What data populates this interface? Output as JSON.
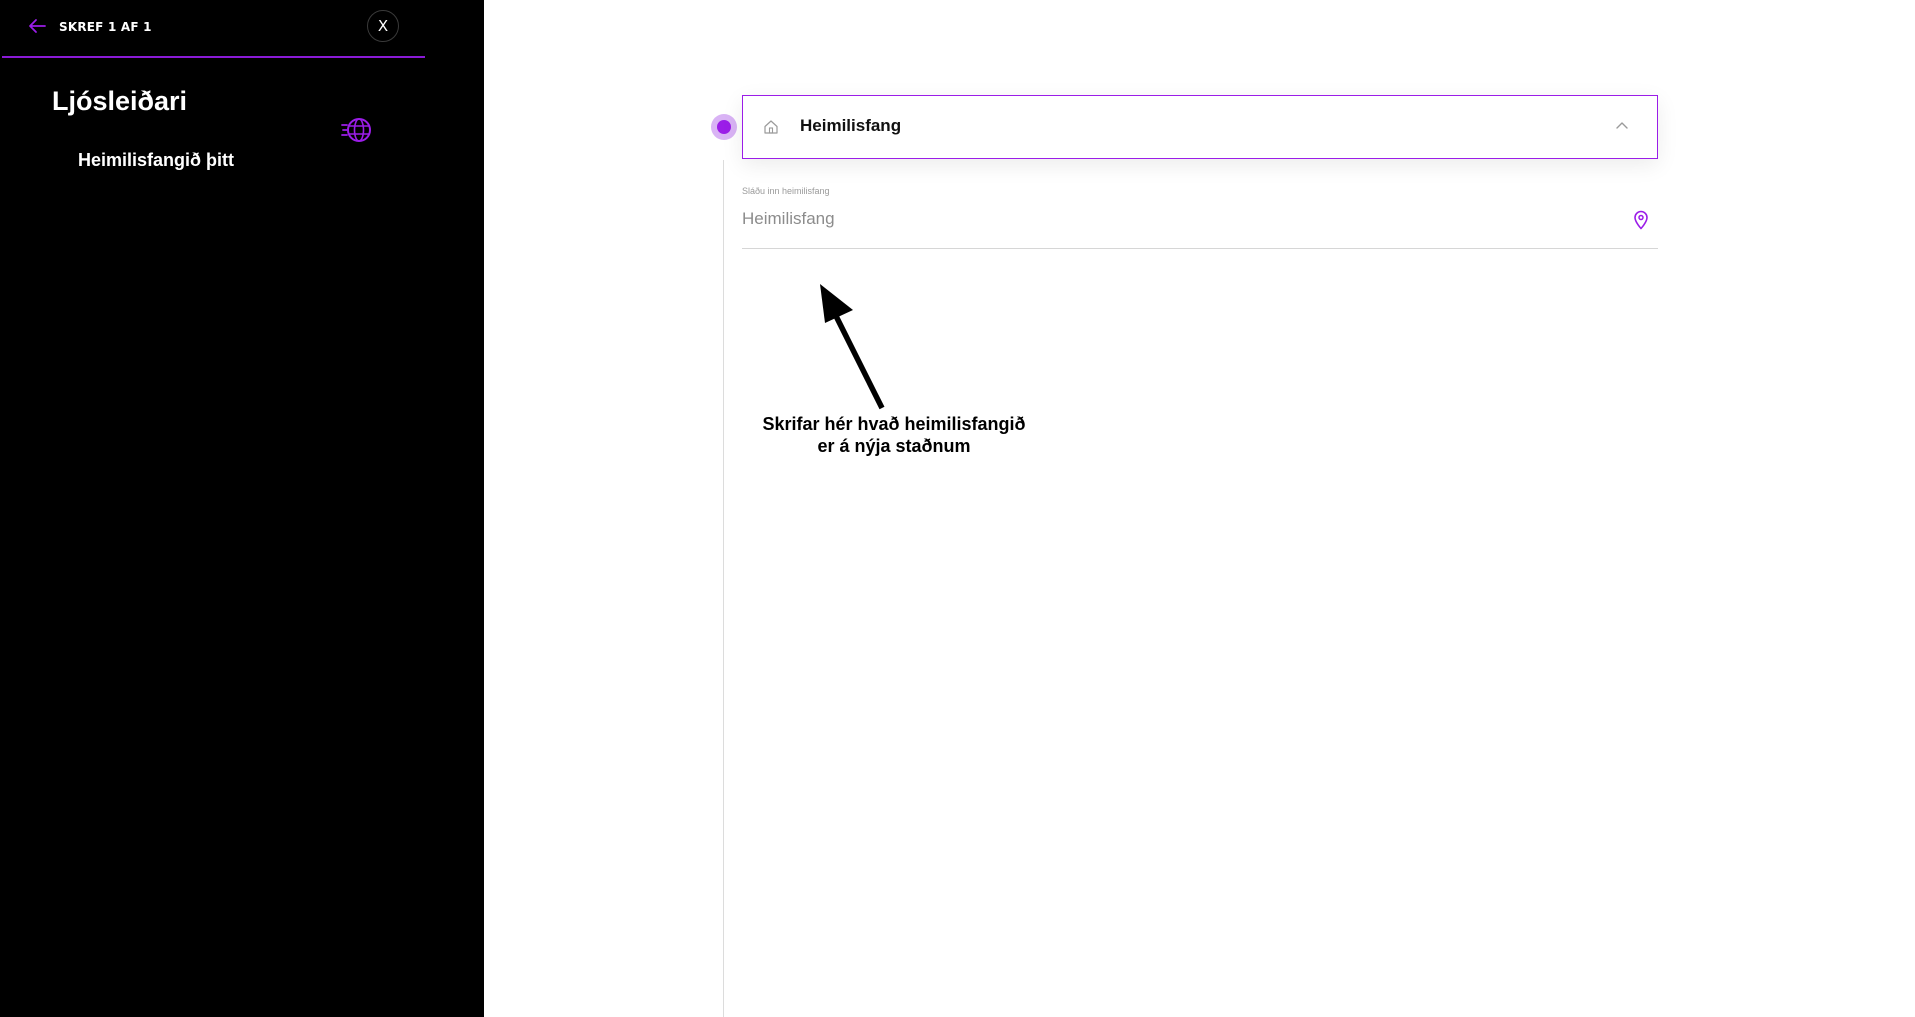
{
  "sidebar": {
    "step_label": "SKREF 1 AF 1",
    "close_label": "X",
    "title": "Ljósleiðari",
    "subtitle": "Heimilisfangið þitt",
    "icons": {
      "back": "arrow-left-icon",
      "close": "close-icon",
      "globe": "globe-icon"
    }
  },
  "section": {
    "title": "Heimilisfang",
    "icons": {
      "leading": "home-icon",
      "toggle": "chevron-up-icon"
    }
  },
  "address_field": {
    "label": "Sláðu inn heimilisfang",
    "placeholder": "Heimilisfang",
    "value": "",
    "icon": "location-pin-icon"
  },
  "annotation": {
    "line1": "Skrifar hér hvað heimilisfangið",
    "line2": "er á nýja staðnum"
  },
  "colors": {
    "accent": "#9b1de8",
    "accent_light": "#d9b3f5",
    "sidebar_bg": "#000000",
    "page_bg": "#ffffff"
  }
}
